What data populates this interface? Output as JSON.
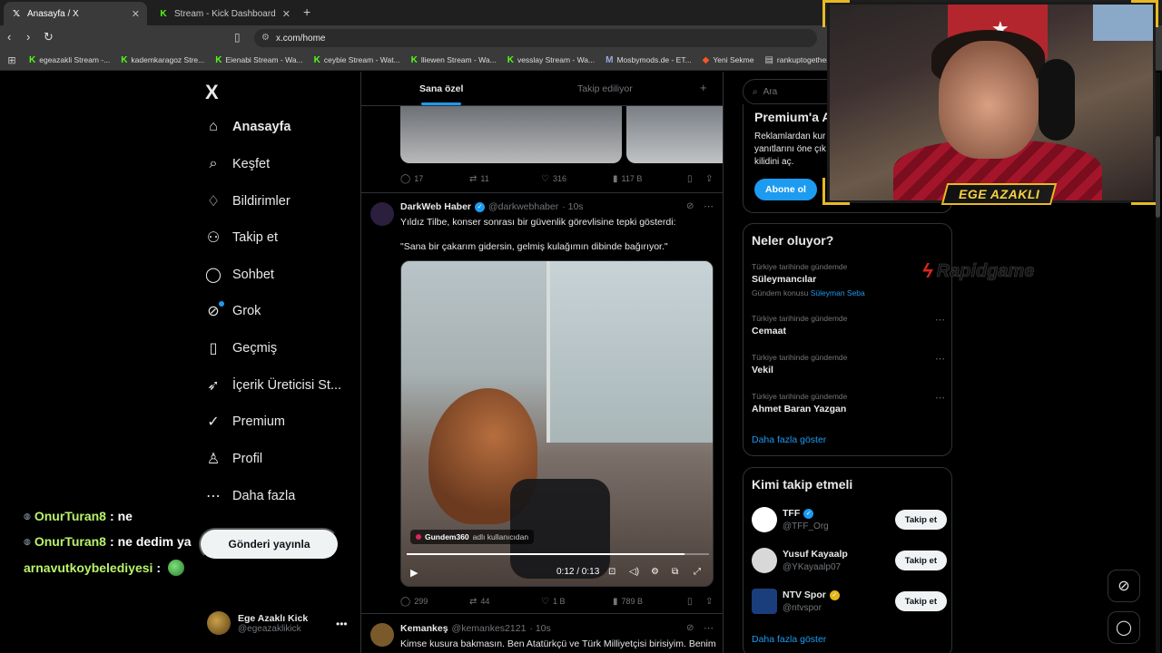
{
  "browser": {
    "tabs": [
      {
        "label": "Anasayfa / X",
        "favicon": "x-icon",
        "active": true
      },
      {
        "label": "Stream - Kick Dashboard",
        "favicon": "kick-icon",
        "active": false
      }
    ],
    "new_tab_glyph": "+",
    "url": "x.com/home",
    "bookmarks": [
      {
        "label": "egeazakli Stream -...",
        "icon": "K"
      },
      {
        "label": "kademkaragoz Stre...",
        "icon": "K"
      },
      {
        "label": "Eienabi Stream - Wa...",
        "icon": "K"
      },
      {
        "label": "ceybie Stream - Wat...",
        "icon": "K"
      },
      {
        "label": "lliewen Stream - Wa...",
        "icon": "K"
      },
      {
        "label": "vesslay Stream - Wa...",
        "icon": "K"
      },
      {
        "label": "Mosbymods.de - ET...",
        "icon": "M"
      },
      {
        "label": "Yeni Sekme",
        "icon": "brave"
      },
      {
        "label": "rankuptogether.xyz...",
        "icon": "page"
      }
    ]
  },
  "nav": {
    "logo": "X",
    "items": [
      {
        "label": "Anasayfa",
        "icon": "home-icon",
        "glyph": "⌂",
        "bold": true
      },
      {
        "label": "Keşfet",
        "icon": "search-icon",
        "glyph": "⌕",
        "bold": false
      },
      {
        "label": "Bildirimler",
        "icon": "bell-icon",
        "glyph": "♢",
        "bold": false
      },
      {
        "label": "Takip et",
        "icon": "add-person-icon",
        "glyph": "⚇",
        "bold": false
      },
      {
        "label": "Sohbet",
        "icon": "chat-icon",
        "glyph": "◯",
        "bold": false
      },
      {
        "label": "Grok",
        "icon": "grok-icon",
        "glyph": "⊘",
        "bold": false,
        "dot": true
      },
      {
        "label": "Geçmiş",
        "icon": "bookmark-icon",
        "glyph": "▯",
        "bold": false
      },
      {
        "label": "İçerik Üreticisi St...",
        "icon": "rocket-icon",
        "glyph": "➶",
        "bold": false
      },
      {
        "label": "Premium",
        "icon": "premium-icon",
        "glyph": "✓",
        "bold": false
      },
      {
        "label": "Profil",
        "icon": "profile-icon",
        "glyph": "♙",
        "bold": false
      },
      {
        "label": "Daha fazla",
        "icon": "more-circle-icon",
        "glyph": "⋯",
        "bold": false
      }
    ],
    "post_button": "Gönderi yayınla",
    "account": {
      "name": "Ege Azaklı Kick",
      "handle": "@egeazaklikick"
    }
  },
  "feed": {
    "tabs": {
      "active": "Sana özel",
      "inactive": "Takip ediliyor"
    },
    "prev_post_stats": {
      "replies": "17",
      "reposts": "11",
      "likes": "316",
      "views": "117 B"
    },
    "post1": {
      "name": "DarkWeb Haber",
      "handle": "@darkwebhaber",
      "time": "· 10s",
      "text": "Yıldız Tilbe, konser sonrası bir güvenlik görevlisine tepki gösterdi:",
      "quote": "\"Sana bir çakarım gidersin, gelmiş kulağımın dibinde bağırıyor.\"",
      "video": {
        "source_user": "Gundem360",
        "source_suffix": "adlı kullanıcıdan",
        "time": "0:12 / 0:13",
        "progress": 0.92
      },
      "stats": {
        "replies": "299",
        "reposts": "44",
        "likes": "1 B",
        "views": "789 B"
      }
    },
    "post2": {
      "name": "Kemankeş",
      "handle": "@kemankes2121",
      "time": "· 10s",
      "text": "Kimse kusura bakmasın. Ben Atatürkçü ve Türk Milliyetçisi birisiyim. Benim"
    }
  },
  "right": {
    "search_placeholder": "Ara",
    "premium": {
      "title": "Premium'a A",
      "desc_lines": [
        "Reklamlardan kur",
        "yanıtlarını öne çık",
        "kilidini aç."
      ],
      "button": "Abone ol"
    },
    "trends": {
      "title": "Neler oluyor?",
      "items": [
        {
          "context": "Türkiye tarihinde gündemde",
          "title": "Süleymancılar",
          "sub_prefix": "Gündem konusu",
          "sub_link": "Süleyman Seba"
        },
        {
          "context": "Türkiye tarihinde gündemde",
          "title": "Cemaat"
        },
        {
          "context": "Türkiye tarihinde gündemde",
          "title": "Vekil"
        },
        {
          "context": "Türkiye tarihinde gündemde",
          "title": "Ahmet Baran Yazgan"
        }
      ],
      "show_more": "Daha fazla göster"
    },
    "who_to_follow": {
      "title": "Kimi takip etmeli",
      "items": [
        {
          "name": "TFF",
          "handle": "@TFF_Org",
          "verified": "blue",
          "avatar_color": "#ffffff"
        },
        {
          "name": "Yusuf Kayaalp",
          "handle": "@YKayaalp07",
          "verified": "",
          "avatar_color": "#d8d8d8"
        },
        {
          "name": "NTV Spor",
          "handle": "@ntvspor",
          "verified": "gold",
          "avatar_color": "#1a3d7c"
        }
      ],
      "follow_label": "Takip et",
      "show_more": "Daha fazla göster"
    }
  },
  "overlay": {
    "streamer_name": "EGE AZAKLI",
    "sponsor": "Rapidgame",
    "chat": [
      {
        "user": "OnurTuran8",
        "sep": " : ",
        "msg": "ne"
      },
      {
        "user": "OnurTuran8",
        "sep": " : ",
        "msg": "ne dedim ya"
      },
      {
        "user": "arnavutkoybelediyesi",
        "sep": " : ",
        "msg": ""
      }
    ]
  },
  "colors": {
    "accent": "#1d9bf0",
    "kick": "#53fc18",
    "frame": "#e8b923"
  }
}
